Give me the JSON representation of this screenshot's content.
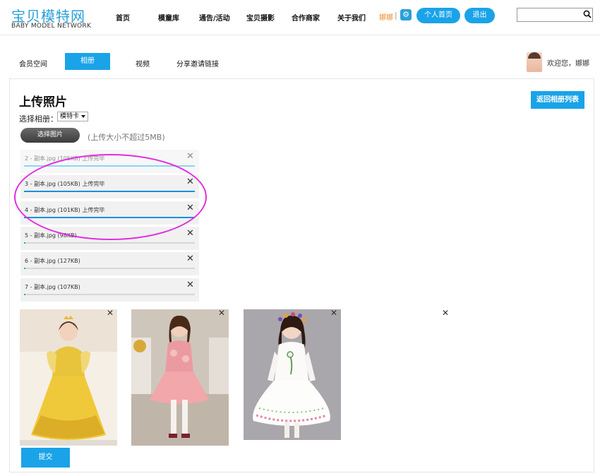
{
  "header": {
    "logo_cn": "宝贝模特网",
    "logo_en": "BABY MODEL NETWORK",
    "nav": [
      "首页",
      "模童库",
      "通告/活动",
      "宝贝摄影",
      "合作商家",
      "关于我们"
    ],
    "username": "娜娜",
    "separator": "|",
    "gear_icon": "gear-icon",
    "home_button": "个人首页",
    "logout_button": "退出",
    "search_placeholder": ""
  },
  "tabs": {
    "items": [
      "会员空间",
      "相册",
      "视频",
      "分享邀请链接"
    ],
    "active": "相册"
  },
  "welcome": "欢迎您，娜娜",
  "upload": {
    "title": "上传照片",
    "back_button": "返回相册列表",
    "album_label": "选择相册：",
    "album_selected": "模特卡",
    "choose_button": "选择图片",
    "size_note": "(上传大小不超过5MB)",
    "items": [
      {
        "name": "2 - 副本.jpg (105KB) 上传完毕",
        "progress": 100
      },
      {
        "name": "3 - 副本.jpg (105KB) 上传完毕",
        "progress": 100
      },
      {
        "name": "4 - 副本.jpg (101KB) 上传完毕",
        "progress": 100
      },
      {
        "name": "5 - 副本.jpg (98KB)",
        "progress": 1
      },
      {
        "name": "6 - 副本.jpg (127KB)",
        "progress": 1
      },
      {
        "name": "7 - 副本.jpg (107KB)",
        "progress": 1
      }
    ],
    "remove_glyph": "✕",
    "submit_button": "提交"
  },
  "colors": {
    "accent": "#1aa3e8",
    "highlight": "#e22de0",
    "username": "#f08a24"
  }
}
